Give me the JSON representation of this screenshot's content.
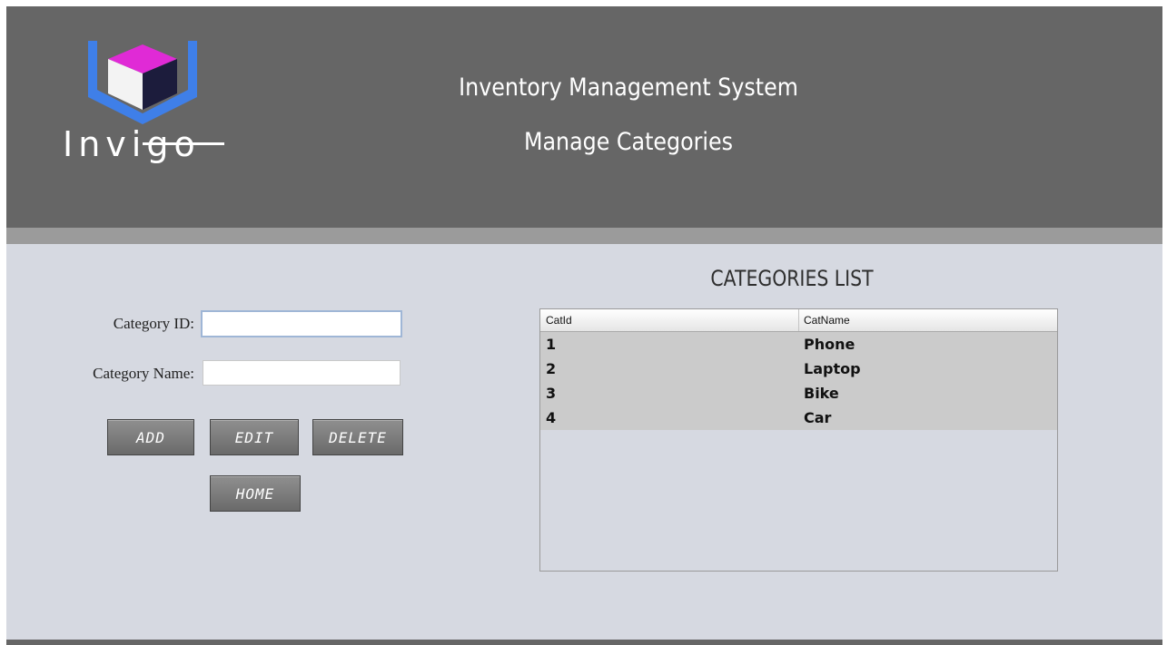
{
  "header": {
    "logo_text": "Invigo",
    "title": "Inventory Management System",
    "subtitle": "Manage Categories",
    "logo_colors": {
      "top": "#e02ad6",
      "front_left": "#f3f3f3",
      "front_right": "#1c1c3c",
      "frame": "#3f7fe8"
    }
  },
  "form": {
    "category_id_label": "Category ID:",
    "category_id_value": "",
    "category_name_label": "Category Name:",
    "category_name_value": ""
  },
  "buttons": {
    "add": "ADD",
    "edit": "EDIT",
    "delete": "DELETE",
    "home": "HOME"
  },
  "list": {
    "title": "CATEGORIES LIST",
    "columns": [
      "CatId",
      "CatName"
    ],
    "rows": [
      {
        "id": "1",
        "name": "Phone"
      },
      {
        "id": "2",
        "name": "Laptop"
      },
      {
        "id": "3",
        "name": "Bike"
      },
      {
        "id": "4",
        "name": "Car"
      }
    ]
  }
}
